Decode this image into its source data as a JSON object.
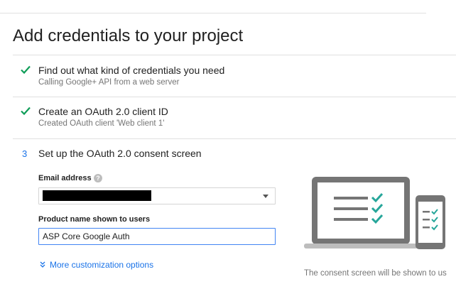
{
  "page": {
    "title": "Add credentials to your project"
  },
  "steps": [
    {
      "status": "complete",
      "title": "Find out what kind of credentials you need",
      "subtitle": "Calling Google+ API from a web server"
    },
    {
      "status": "complete",
      "title": "Create an OAuth 2.0 client ID",
      "subtitle": "Created OAuth client 'Web client 1'"
    },
    {
      "status": "active",
      "number": "3",
      "title": "Set up the OAuth 2.0 consent screen"
    }
  ],
  "form": {
    "email_label": "Email address",
    "help_icon_glyph": "?",
    "email_value_redacted": true,
    "product_label": "Product name shown to users",
    "product_value": "ASP Core Google Auth",
    "more_options": "More customization options"
  },
  "illustration": {
    "text": "The consent screen will be shown to us"
  },
  "colors": {
    "check_green": "#0f9d58",
    "link_blue": "#1a73e8",
    "input_focus_blue": "#4285f4",
    "device_gray": "#757575"
  },
  "icons": [
    "check-icon",
    "help-icon",
    "dropdown-caret-icon",
    "chevron-double-down-icon",
    "laptop-icon",
    "phone-icon"
  ]
}
